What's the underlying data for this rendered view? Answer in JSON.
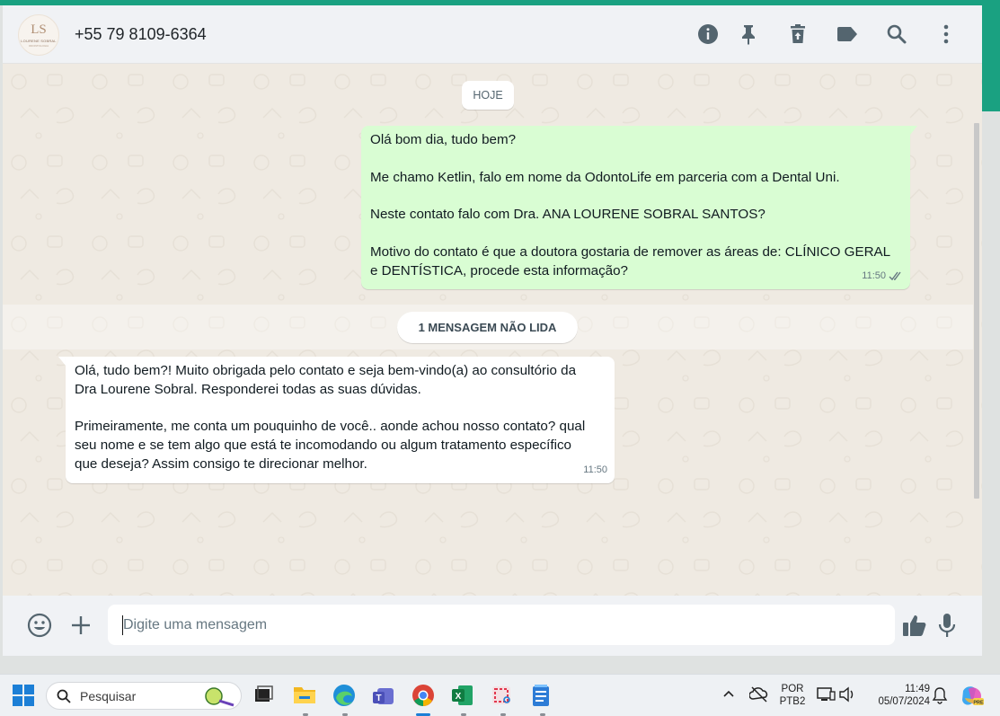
{
  "header": {
    "contact_name": "+55 79 8109-6364",
    "avatar": {
      "monogram": "LS",
      "brand_line1": "LOURENE SOBRAL",
      "brand_line2": "ODONTOLOGIA"
    },
    "icons": [
      "info-icon",
      "pin-icon",
      "delete-icon",
      "label-icon",
      "search-icon",
      "more-icon"
    ]
  },
  "chat": {
    "date_separator": "HOJE",
    "unread_notice": "1 MENSAGEM NÃO LIDA",
    "messages": [
      {
        "direction": "outgoing",
        "lines": [
          "Olá bom dia, tudo bem?",
          "",
          "Me chamo Ketlin, falo em nome da OdontoLife em parceria com a Dental Uni.",
          "",
          "Neste contato falo com Dra. ANA LOURENE SOBRAL SANTOS?",
          "",
          "Motivo do contato é que a doutora gostaria de remover as áreas de: CLÍNICO GERAL",
          "e DENTÍSTICA, procede esta informação?"
        ],
        "time": "11:50",
        "status": "read"
      },
      {
        "direction": "incoming",
        "lines": [
          "Olá, tudo bem?! Muito obrigada pelo contato e seja bem-vindo(a) ao consultório da",
          "Dra Lourene Sobral. Responderei todas as suas dúvidas.",
          "",
          "Primeiramente, me conta um pouquinho de você.. aonde achou nosso contato? qual",
          "seu nome e se tem algo que está te incomodando ou algum tratamento específico",
          "que deseja? Assim consigo te direcionar melhor."
        ],
        "time": "11:50"
      }
    ]
  },
  "composer": {
    "placeholder": "Digite uma mensagem",
    "value": ""
  },
  "taskbar": {
    "search_label": "Pesquisar",
    "language": "POR",
    "keyboard": "PTB2",
    "time": "11:49",
    "date": "05/07/2024",
    "apps": [
      "windows-start",
      "file-explorer",
      "edge",
      "teams",
      "chrome",
      "excel",
      "snipping-tool",
      "notepad",
      "terminal"
    ]
  },
  "colors": {
    "accent": "#1aa181",
    "outgoing_bubble": "#d9fdd3",
    "incoming_bubble": "#ffffff",
    "chat_bg": "#efeae2",
    "read_ticks": "#667781"
  }
}
